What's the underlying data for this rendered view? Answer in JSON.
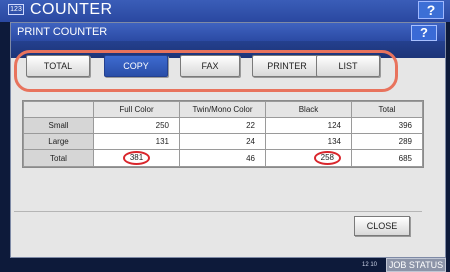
{
  "outer": {
    "icon_text": "123",
    "title": "COUNTER",
    "help": "?"
  },
  "dialog": {
    "title": "PRINT COUNTER",
    "help": "?",
    "tabs": [
      {
        "label": "TOTAL",
        "active": false
      },
      {
        "label": "COPY",
        "active": true
      },
      {
        "label": "FAX",
        "active": false
      },
      {
        "label": "PRINTER",
        "active": false
      },
      {
        "label": "LIST",
        "active": false
      }
    ],
    "table": {
      "headers": [
        "",
        "Full Color",
        "Twin/Mono Color",
        "Black",
        "Total"
      ],
      "rows": [
        {
          "label": "Small",
          "values": [
            "250",
            "22",
            "124",
            "396"
          ]
        },
        {
          "label": "Large",
          "values": [
            "131",
            "24",
            "134",
            "289"
          ]
        },
        {
          "label": "Total",
          "values": [
            "381",
            "46",
            "258",
            "685"
          ]
        }
      ]
    },
    "close_label": "CLOSE"
  },
  "footer": {
    "time": "12 10",
    "job_status": "JOB STATUS"
  },
  "colors": {
    "accent_blue": "#2a4ea8",
    "highlight_red": "#d9262c",
    "tab_outline": "#e8735d"
  }
}
